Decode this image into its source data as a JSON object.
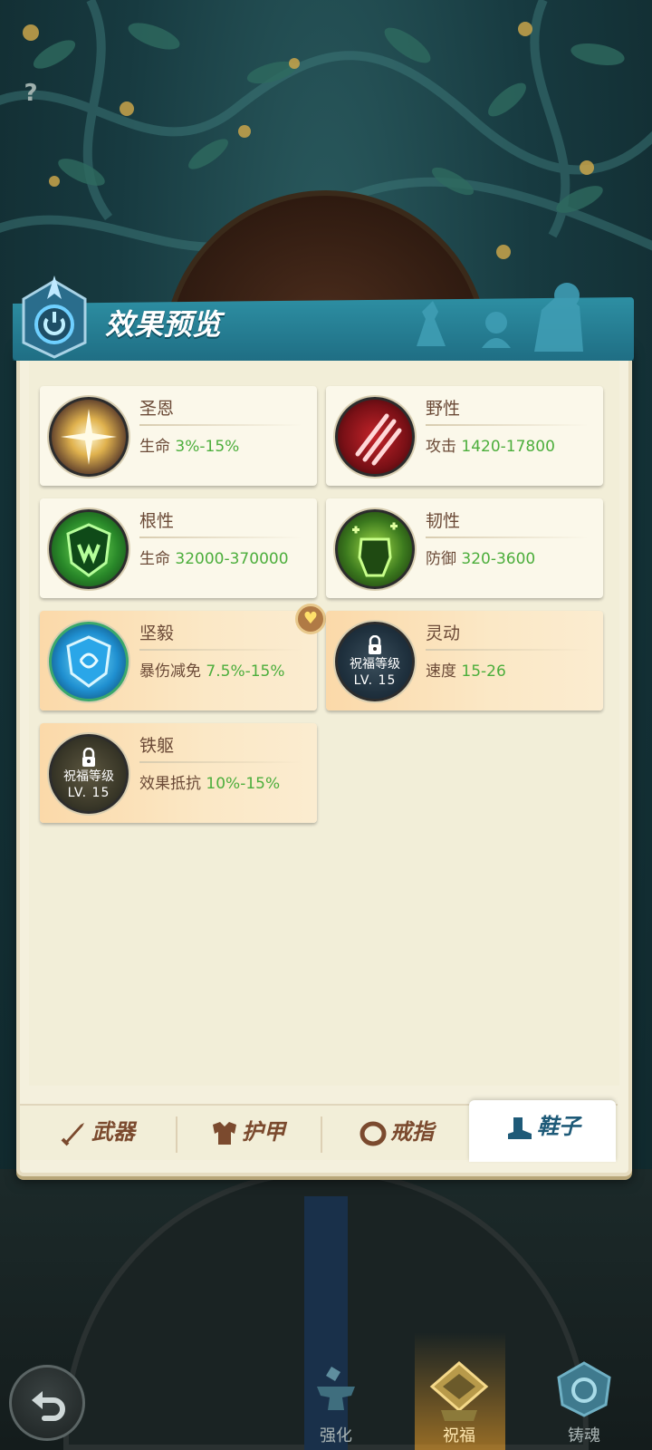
{
  "help": {
    "icon": "question-icon",
    "glyph": "?"
  },
  "header": {
    "title": "效果预览"
  },
  "effects": [
    {
      "name": "圣恩",
      "stat_label": "生命",
      "stat_value": "3%-15%",
      "icon": "holy-light-icon",
      "locked": false,
      "highlight": false
    },
    {
      "name": "野性",
      "stat_label": "攻击",
      "stat_value": "1420-17800",
      "icon": "claw-slash-icon",
      "locked": false,
      "highlight": false
    },
    {
      "name": "根性",
      "stat_label": "生命",
      "stat_value": "32000-370000",
      "icon": "root-shield-icon",
      "locked": false,
      "highlight": false
    },
    {
      "name": "韧性",
      "stat_label": "防御",
      "stat_value": "320-3600",
      "icon": "green-fist-icon",
      "locked": false,
      "highlight": false
    },
    {
      "name": "坚毅",
      "stat_label": "暴伤减免",
      "stat_value": "7.5%-15%",
      "icon": "blue-shield-icon",
      "locked": false,
      "highlight": true
    },
    {
      "name": "灵动",
      "stat_label": "速度",
      "stat_value": "15-26",
      "icon": "agility-icon",
      "locked": true,
      "highlight": true,
      "lock_text": "祝福等级",
      "lock_level": "LV. 15"
    },
    {
      "name": "铁躯",
      "stat_label": "效果抵抗",
      "stat_value": "10%-15%",
      "icon": "iron-body-icon",
      "locked": true,
      "highlight": true,
      "lock_text": "祝福等级",
      "lock_level": "LV. 15"
    }
  ],
  "favorite_badge": {
    "icon": "heart-icon",
    "glyph": "♥"
  },
  "tabs": [
    {
      "label": "武器",
      "icon": "sword-icon",
      "active": false
    },
    {
      "label": "护甲",
      "icon": "armor-icon",
      "active": false
    },
    {
      "label": "戒指",
      "icon": "ring-icon",
      "active": false
    },
    {
      "label": "鞋子",
      "icon": "boot-icon",
      "active": true
    }
  ],
  "bottom_nav": [
    {
      "label": "强化",
      "icon": "anvil-icon",
      "active": false
    },
    {
      "label": "祝福",
      "icon": "blessing-emblem-icon",
      "active": true
    },
    {
      "label": "铸魂",
      "icon": "soul-forge-icon",
      "active": false
    }
  ],
  "colors": {
    "accent_green": "#4cae3c",
    "text_brown": "#6b4a37",
    "banner_teal": "#2d8fa3",
    "tab_active_text": "#1e5a78"
  }
}
